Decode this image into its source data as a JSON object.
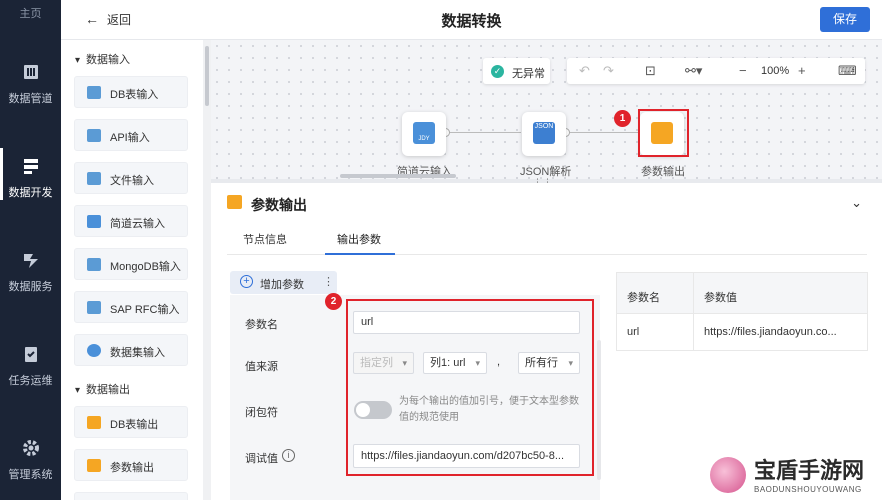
{
  "nav": {
    "top": "主页",
    "items": [
      {
        "label": "数据管道",
        "icon": "pipeline-icon"
      },
      {
        "label": "数据开发",
        "icon": "dev-icon",
        "active": true
      },
      {
        "label": "数据服务",
        "icon": "service-icon"
      },
      {
        "label": "任务运维",
        "icon": "ops-icon"
      },
      {
        "label": "管理系统",
        "icon": "gear-icon"
      }
    ]
  },
  "header": {
    "back": "返回",
    "title": "数据转换",
    "save": "保存"
  },
  "sidebar": {
    "group1": "数据输入",
    "inputs": [
      "DB表输入",
      "API输入",
      "文件输入",
      "简道云输入",
      "MongoDB输入",
      "SAP RFC输入",
      "数据集输入"
    ],
    "group2": "数据输出",
    "outputs": [
      "DB表输出",
      "参数输出"
    ]
  },
  "canvas": {
    "status": "无异常",
    "zoom": "100%",
    "nodes": [
      "简道云输入",
      "JSON解析",
      "参数输出"
    ],
    "node_icon_texts": [
      "JDY",
      "JSON"
    ],
    "badge1": "1"
  },
  "panel": {
    "title": "参数输出",
    "tabs": [
      "节点信息",
      "输出参数"
    ],
    "add_param": "增加参数",
    "badge2": "2",
    "labels": {
      "name": "参数名",
      "source": "值来源",
      "closure": "闭包符",
      "debug": "调试值"
    },
    "name_value": "url",
    "source_type": "指定列",
    "column": "列1: url",
    "row": "所有行",
    "separator": ",",
    "hint": "为每个输出的值加引号，便于文本型参数值的规范使用",
    "debug_value": "https://files.jiandaoyun.com/d207bc50-8..."
  },
  "table": {
    "headers": [
      "参数名",
      "参数值"
    ],
    "rows": [
      [
        "url",
        "https://files.jiandaoyun.co..."
      ]
    ]
  },
  "watermark": {
    "big": "宝盾手游网",
    "small": "BAODUNSHOUYOUWANG"
  },
  "colors": {
    "accent": "#2f6fd8",
    "nav_bg": "#1b2436",
    "highlight": "#e0232b"
  }
}
